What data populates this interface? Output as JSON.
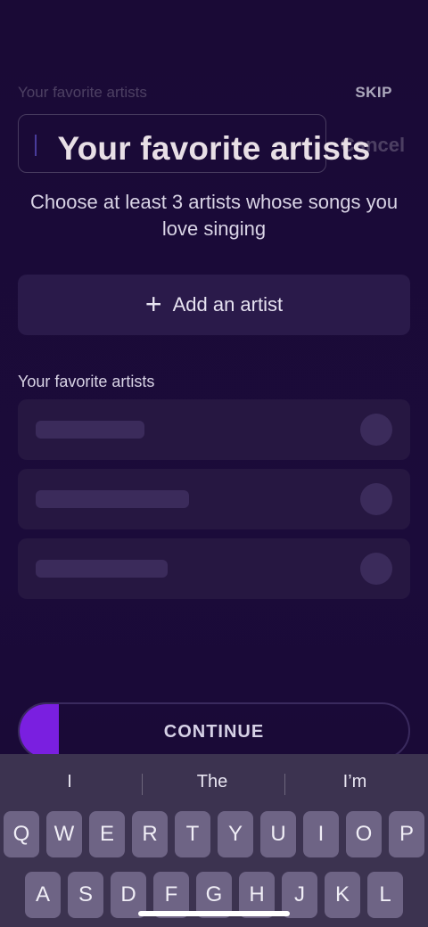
{
  "header": {
    "faded_title": "Your favorite artists",
    "skip_label": "SKIP",
    "cancel_label": "Cancel"
  },
  "title": "Your favorite artists",
  "subtitle": "Choose at least 3 artists whose songs you love singing",
  "add_artist": {
    "label": "Add an artist",
    "icon": "plus-icon"
  },
  "section_label": "Your favorite artists",
  "artists": [
    {
      "placeholder": "",
      "status": "empty"
    },
    {
      "placeholder": "",
      "status": "empty"
    },
    {
      "placeholder": "",
      "status": "empty"
    }
  ],
  "continue": {
    "label": "CONTINUE",
    "progress_fraction": 0.1
  },
  "keyboard": {
    "suggestions": [
      "I",
      "The",
      "I’m"
    ],
    "row1": [
      "Q",
      "W",
      "E",
      "R",
      "T",
      "Y",
      "U",
      "I",
      "O",
      "P"
    ],
    "row2": [
      "A",
      "S",
      "D",
      "F",
      "G",
      "H",
      "J",
      "K",
      "L"
    ]
  },
  "colors": {
    "accent": "#7a1fe0",
    "background": "#1b0b3a"
  }
}
